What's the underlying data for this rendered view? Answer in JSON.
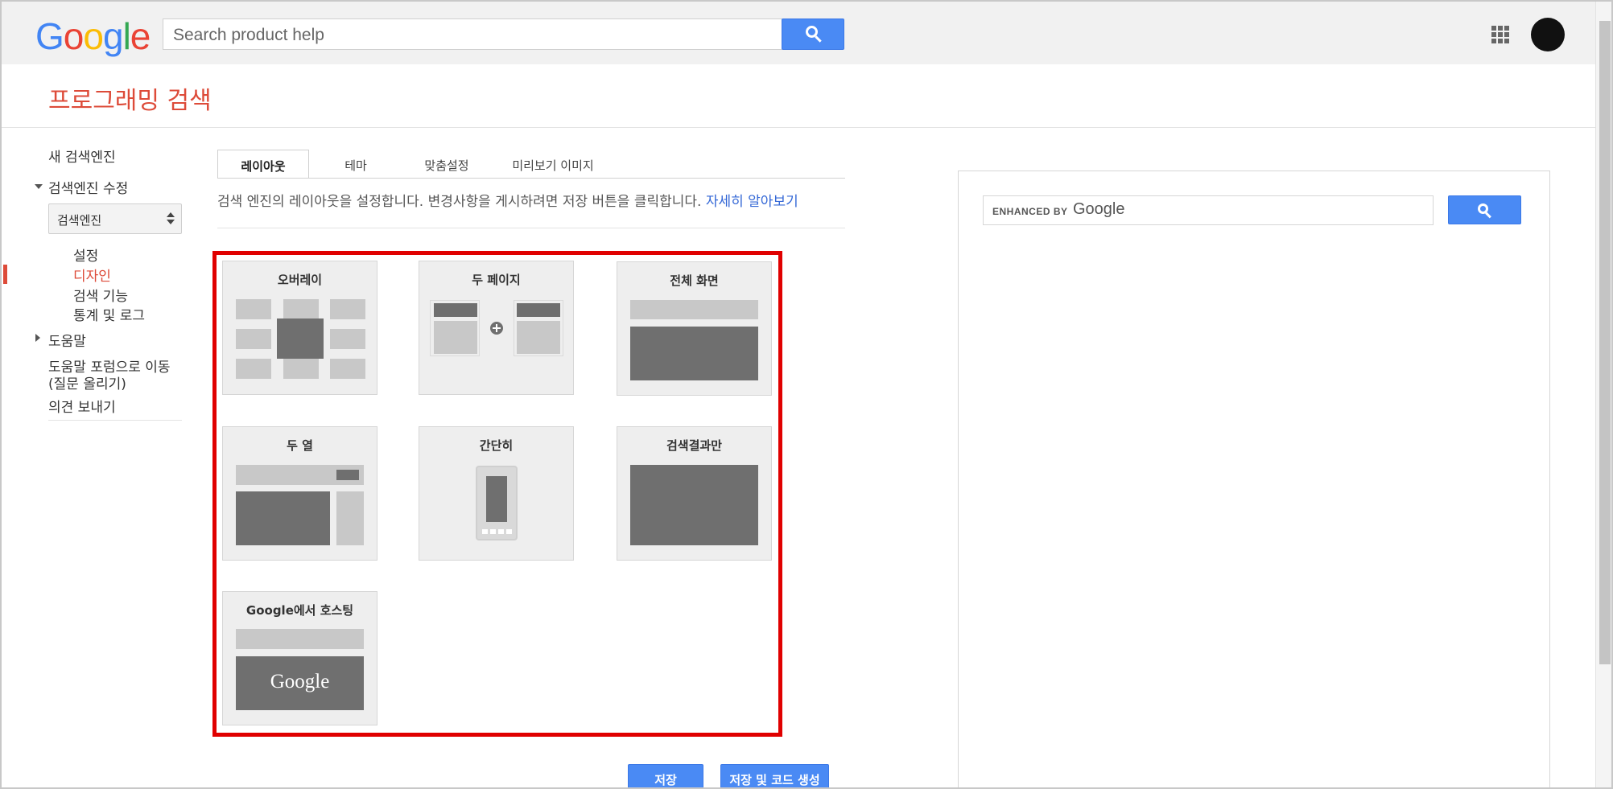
{
  "header": {
    "logo_letters": [
      {
        "ch": "G",
        "color": "#4285f4"
      },
      {
        "ch": "o",
        "color": "#ea4335"
      },
      {
        "ch": "o",
        "color": "#fbbc05"
      },
      {
        "ch": "g",
        "color": "#4285f4"
      },
      {
        "ch": "l",
        "color": "#34a853"
      },
      {
        "ch": "e",
        "color": "#ea4335"
      }
    ],
    "search_placeholder": "Search product help",
    "search_icon": "search-icon",
    "apps_icon": "apps-grid-icon"
  },
  "page_title": "프로그래밍 검색",
  "sidebar": {
    "new_engine": "새 검색엔진",
    "edit_engine": "검색엔진 수정",
    "engine_select_value": "검색엔진",
    "sub_items": [
      {
        "label": "설정",
        "active": false
      },
      {
        "label": "디자인",
        "active": true
      },
      {
        "label": "검색 기능",
        "active": false
      },
      {
        "label": "통계 및 로그",
        "active": false
      }
    ],
    "help": "도움말",
    "forum_line1": "도움말 포럼으로 이동",
    "forum_line2": "(질문 올리기)",
    "feedback": "의견 보내기"
  },
  "tabs": [
    {
      "label": "레이아웃",
      "active": true
    },
    {
      "label": "테마",
      "active": false
    },
    {
      "label": "맞춤설정",
      "active": false
    },
    {
      "label": "미리보기 이미지",
      "active": false
    }
  ],
  "description": {
    "text": "검색 엔진의 레이아웃을 설정합니다. 변경사항을 게시하려면 저장 버튼을 클릭합니다.",
    "link": "자세히 알아보기"
  },
  "layouts": [
    {
      "label": "오버레이"
    },
    {
      "label": "두 페이지"
    },
    {
      "label": "전체 화면"
    },
    {
      "label": "두 열"
    },
    {
      "label": "간단히"
    },
    {
      "label": "검색결과만"
    },
    {
      "label": "Google에서 호스팅",
      "logo": "Google"
    }
  ],
  "buttons": {
    "save": "저장",
    "save_and_code": "저장 및 코드 생성"
  },
  "preview": {
    "enhanced_by": "ENHANCED BY",
    "google": "Google"
  },
  "colors": {
    "accent_red": "#dd4b39",
    "button_blue": "#4a8af4",
    "link_blue": "#3367d6",
    "highlight_red": "#e00000"
  }
}
